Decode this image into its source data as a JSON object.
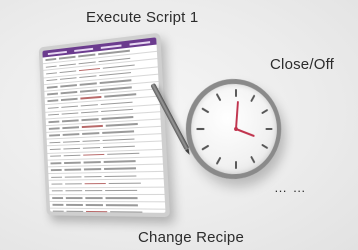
{
  "scene": {
    "actions": {
      "top": "Execute Script 1",
      "right": "Close/Off",
      "bottom": "Change Recipe",
      "more": "… …"
    }
  },
  "icons": {
    "tablet": "tablet-icon",
    "pen": "stylus-icon",
    "clock": "clock-icon"
  },
  "colors": {
    "table_header": "#6b3b8e",
    "clock_hands": "#c0334d"
  }
}
